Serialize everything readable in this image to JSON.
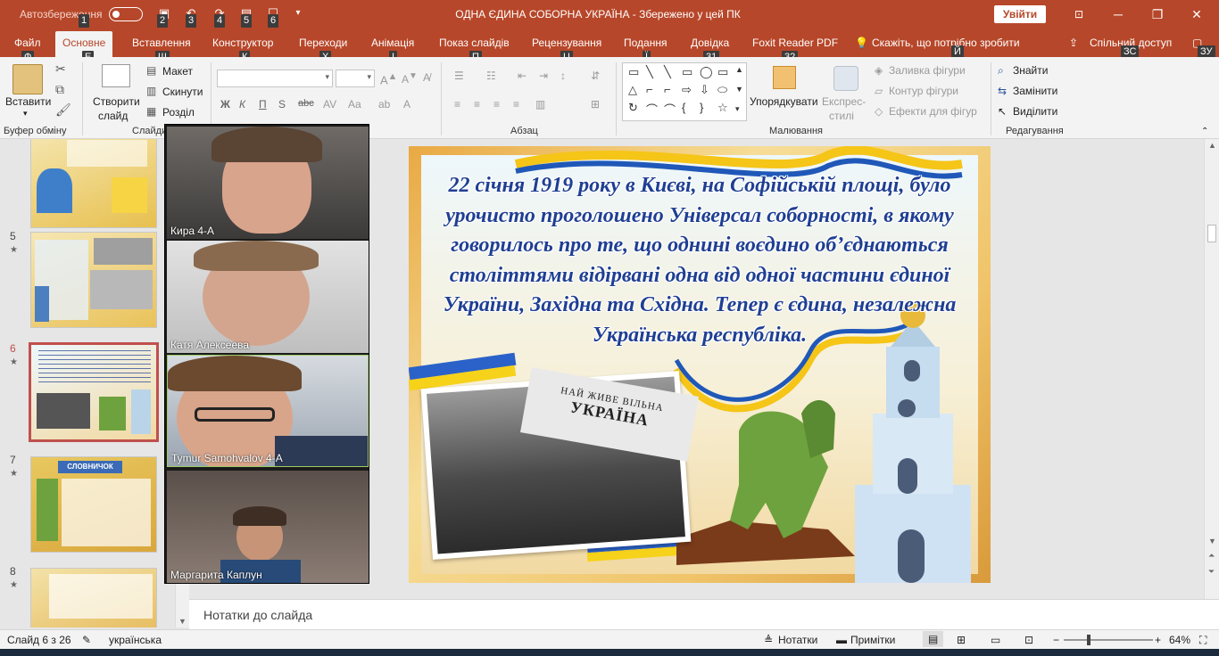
{
  "window": {
    "autosave_label": "Автозбереження",
    "autosave_state": "off",
    "title": "ОДНА ЄДИНА СОБОРНА УКРАЇНА  -  Збережено у цей ПК",
    "signin": "Увійти"
  },
  "keytips": {
    "qa1": "1",
    "qa2": "2",
    "qa3": "3",
    "qa4": "4",
    "qa5": "5",
    "qa6": "6",
    "file": "Ф",
    "home": "Е",
    "insert": "Щ",
    "design": "К",
    "transitions": "Х",
    "animations": "І",
    "slideshow": "П",
    "review": "Ц",
    "view": "Ї",
    "help": "31",
    "foxit": "32",
    "tellme": "Й",
    "share": "ЗС",
    "comments": "ЗУ"
  },
  "tabs": [
    {
      "label": "Файл"
    },
    {
      "label": "Основне"
    },
    {
      "label": "Вставлення"
    },
    {
      "label": "Конструктор"
    },
    {
      "label": "Переходи"
    },
    {
      "label": "Анімація"
    },
    {
      "label": "Показ слайдів"
    },
    {
      "label": "Рецензування"
    },
    {
      "label": "Подання"
    },
    {
      "label": "Довідка"
    },
    {
      "label": "Foxit Reader PDF"
    },
    {
      "label": "Скажіть, що потрібно зробити"
    },
    {
      "label": "Спільний доступ"
    }
  ],
  "ribbon": {
    "paste": "Вставити",
    "clipboard_group": "Буфер обміну",
    "new_slide_1": "Створити",
    "new_slide_2": "слайд",
    "layout": "Макет",
    "reset": "Скинути",
    "section": "Розділ",
    "slides_group": "Слайди",
    "bold": "Ж",
    "italic": "К",
    "underline": "П",
    "strike": "S",
    "shadow": "abc",
    "paragraph_group": "Абзац",
    "arrange": "Упорядкувати",
    "quick_styles_1": "Експрес-",
    "quick_styles_2": "стилі",
    "shape_fill": "Заливка фігури",
    "shape_outline": "Контур фігури",
    "shape_effects": "Ефекти для фігур",
    "drawing_group": "Малювання",
    "find": "Знайти",
    "replace": "Замінити",
    "select": "Виділити",
    "editing_group": "Редагування"
  },
  "thumbnails": [
    {
      "num": "",
      "star": ""
    },
    {
      "num": "5",
      "star": "★"
    },
    {
      "num": "6",
      "star": "★"
    },
    {
      "num": "7",
      "star": "★"
    },
    {
      "num": "8",
      "star": "★"
    }
  ],
  "thumb7_title": "СЛОВНИЧОК",
  "slide": {
    "text": "22 січня 1919 року в Києві, на  Софійській площі, було урочисто проголошено Універсал соборності, в якому говорилось про те, що однині воєдино об’єднаються століттями відірвані одна від одної частини єдиної України, Західна та Східна. Тепер є єдина, незалежна Українська республіка.",
    "banner_small": "НАЙ ЖИВЕ ВІЛЬНА",
    "banner_big": "УКРАЇНА"
  },
  "participants": [
    {
      "name": "Кира 4-А"
    },
    {
      "name": "Катя Алексеева"
    },
    {
      "name": "Tymur Samohvalov 4-A"
    },
    {
      "name": "Маргарита Каплун"
    }
  ],
  "notes_placeholder": "Нотатки до слайда",
  "status": {
    "slide_counter": "Слайд 6 з 26",
    "language": "українська",
    "notes": "Нотатки",
    "comments": "Примітки",
    "zoom": "64%"
  },
  "colors": {
    "accent": "#b7472a",
    "slide_text": "#1f3f93",
    "active_thumb": "#c0504d"
  }
}
